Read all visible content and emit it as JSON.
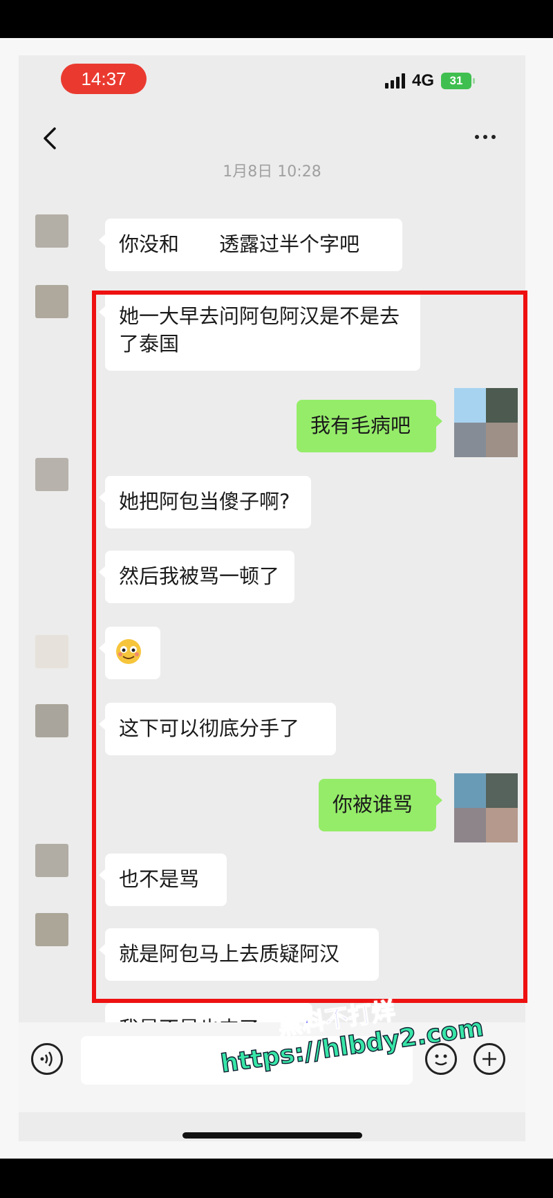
{
  "status_bar": {
    "time": "14:37",
    "network": "4G",
    "battery": "31"
  },
  "chat": {
    "timestamp": "1月8日 10:28",
    "messages": [
      {
        "side": "left",
        "text": "你没和　　透露过半个字吧"
      },
      {
        "side": "left",
        "text": "她一大早去问阿包阿汉是不是去了泰国"
      },
      {
        "side": "right",
        "text": "我有毛病吧"
      },
      {
        "side": "left",
        "text": "她把阿包当傻子啊?"
      },
      {
        "side": "left",
        "text": "然后我被骂一顿了"
      },
      {
        "side": "left",
        "text": "",
        "emoji": "smile-emoji"
      },
      {
        "side": "left",
        "text": "这下可以彻底分手了"
      },
      {
        "side": "right",
        "text": "你被谁骂"
      },
      {
        "side": "left",
        "text": "也不是骂"
      },
      {
        "side": "left",
        "text": "就是阿包马上去质疑阿汉"
      },
      {
        "side": "left",
        "text": "我是不是也丰了"
      }
    ]
  },
  "watermark": {
    "line1": "黑料不打烊",
    "line2": "https://hlbdy2.com"
  },
  "colors": {
    "highlight": "#ee1111",
    "green_bubble": "#95ec69",
    "time_pill": "#ea3a30"
  }
}
